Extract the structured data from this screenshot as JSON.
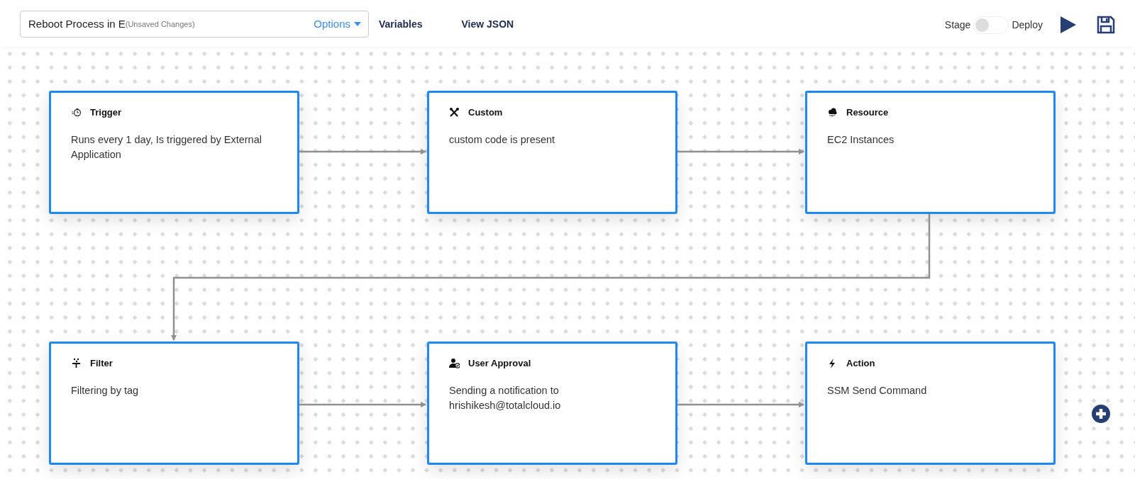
{
  "header": {
    "title": "Reboot Process in E",
    "note": "(Unsaved Changes)",
    "options": "Options",
    "links": [
      "Variables",
      "View JSON"
    ],
    "toggle": {
      "left_label": "Stage",
      "right_label": "Deploy",
      "on": false
    }
  },
  "nodes": [
    {
      "kind": "trigger",
      "title": "Trigger",
      "text": "Runs every 1 day, Is triggered by External Application"
    },
    {
      "kind": "custom",
      "title": "Custom",
      "text": "custom code is present"
    },
    {
      "kind": "resource",
      "title": "Resource",
      "text": "EC2 Instances"
    },
    {
      "kind": "filter",
      "title": "Filter",
      "text": "Filtering by tag"
    },
    {
      "kind": "approval",
      "title": "User Approval",
      "text": "Sending a notification to hrishikesh@totalcloud.io"
    },
    {
      "kind": "action",
      "title": "Action",
      "text": "SSM Send Command"
    }
  ]
}
